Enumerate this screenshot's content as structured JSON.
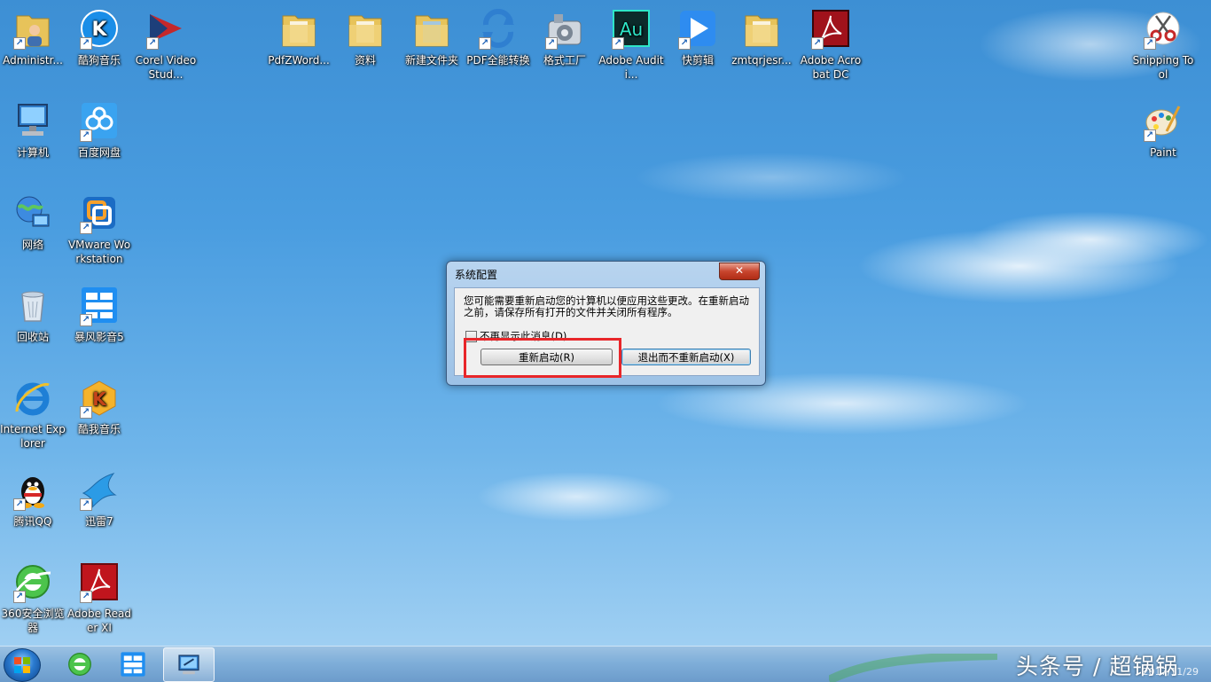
{
  "desktop_icons": [
    {
      "label": "Administr...",
      "icon": "user-folder-icon"
    },
    {
      "label": "酷狗音乐",
      "icon": "kugou-icon"
    },
    {
      "label": "Corel VideoStud...",
      "icon": "corel-video-icon"
    },
    {
      "label": "PdfZWord...",
      "icon": "folder-icon"
    },
    {
      "label": "资料",
      "icon": "folder-icon"
    },
    {
      "label": "新建文件夹",
      "icon": "folder-icon"
    },
    {
      "label": "PDF全能转换",
      "icon": "pdf-converter-icon"
    },
    {
      "label": "格式工厂",
      "icon": "format-factory-icon"
    },
    {
      "label": "Adobe Auditi...",
      "icon": "adobe-audition-icon"
    },
    {
      "label": "快剪辑",
      "icon": "quick-editor-icon"
    },
    {
      "label": "zmtqrjesr...",
      "icon": "folder-icon"
    },
    {
      "label": "Adobe Acrobat DC",
      "icon": "adobe-acrobat-icon"
    },
    {
      "label": "Snipping Tool",
      "icon": "scissors-icon"
    },
    {
      "label": "计算机",
      "icon": "computer-icon"
    },
    {
      "label": "百度网盘",
      "icon": "baidu-cloud-icon"
    },
    {
      "label": "Paint",
      "icon": "paint-icon"
    },
    {
      "label": "网络",
      "icon": "network-icon"
    },
    {
      "label": "VMware Workstation",
      "icon": "vmware-icon"
    },
    {
      "label": "回收站",
      "icon": "recycle-bin-icon"
    },
    {
      "label": "暴风影音5",
      "icon": "baofeng-icon"
    },
    {
      "label": "Internet Explorer",
      "icon": "internet-explorer-icon"
    },
    {
      "label": "酷我音乐",
      "icon": "kuwo-icon"
    },
    {
      "label": "腾讯QQ",
      "icon": "qq-penguin-icon"
    },
    {
      "label": "迅雷7",
      "icon": "xunlei-bird-icon"
    },
    {
      "label": "360安全浏览器",
      "icon": "360-browser-icon"
    },
    {
      "label": "Adobe Reader XI",
      "icon": "adobe-reader-icon"
    }
  ],
  "dialog": {
    "title": "系统配置",
    "close_label": "✕",
    "message": "您可能需要重新启动您的计算机以便应用这些更改。在重新启动之前，请保存所有打开的文件并关闭所有程序。",
    "checkbox_label": "不再显示此消息(D)",
    "restart_button": "重新启动(R)",
    "exit_button": "退出而不重新启动(X)"
  },
  "taskbar": {
    "items": [
      "360-browser-icon",
      "baofeng-icon",
      "system-config-icon"
    ],
    "watermark": "头条号 / 超锅锅",
    "date": "2017/11/29"
  },
  "colors": {
    "highlight": "#e8262a",
    "close_button": "#c8452e"
  }
}
